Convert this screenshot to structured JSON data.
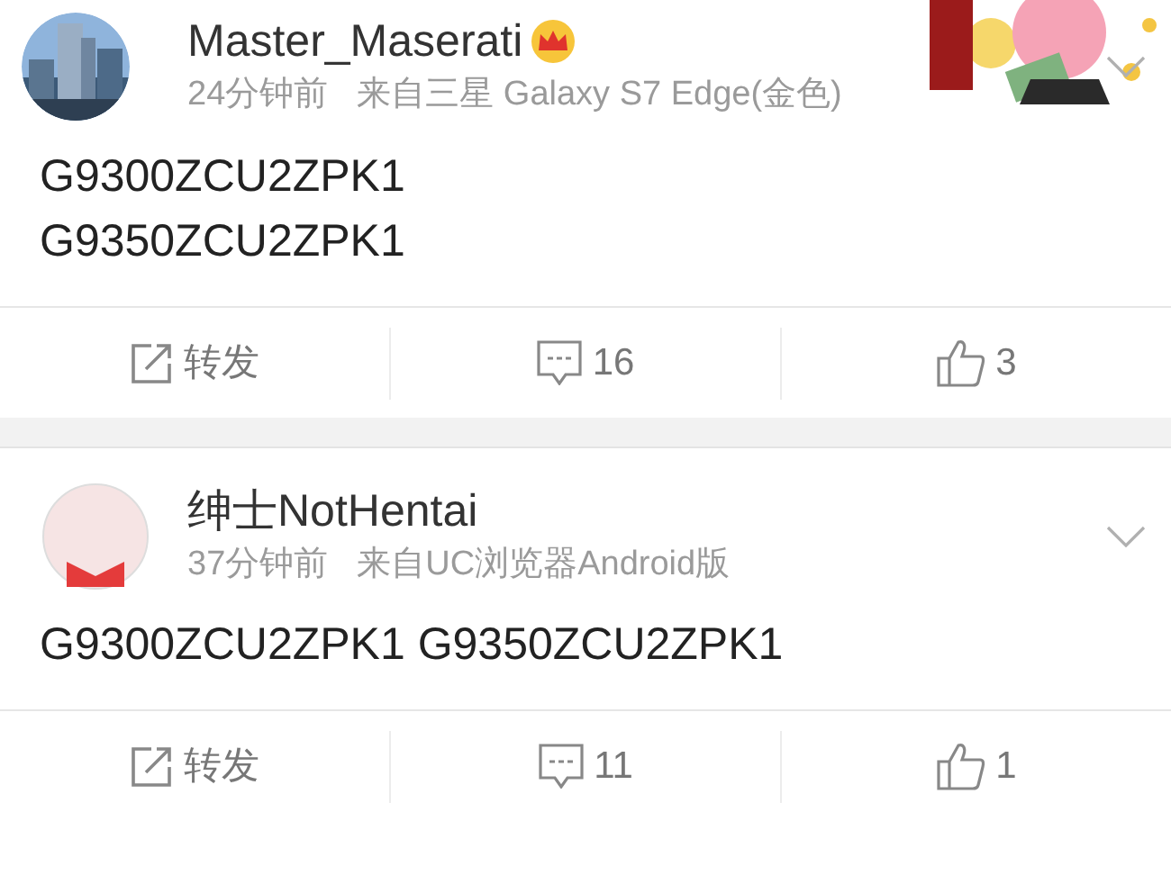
{
  "posts": [
    {
      "author": "Master_Maserati",
      "vip": true,
      "time": "24分钟前",
      "source": "来自三星 Galaxy S7 Edge(金色)",
      "lines": [
        "G9300ZCU2ZPK1",
        "G9350ZCU2ZPK1"
      ],
      "actions": {
        "repost": "转发",
        "comments": "16",
        "likes": "3"
      }
    },
    {
      "avatar": {
        "kind": "cartoon"
      },
      "author": "绅士NotHentai",
      "vip": false,
      "time": "37分钟前",
      "source": "来自UC浏览器Android版",
      "lines": [
        "G9300ZCU2ZPK1 G9350ZCU2ZPK1"
      ],
      "actions": {
        "repost": "转发",
        "comments": "11",
        "likes": "1"
      }
    }
  ]
}
